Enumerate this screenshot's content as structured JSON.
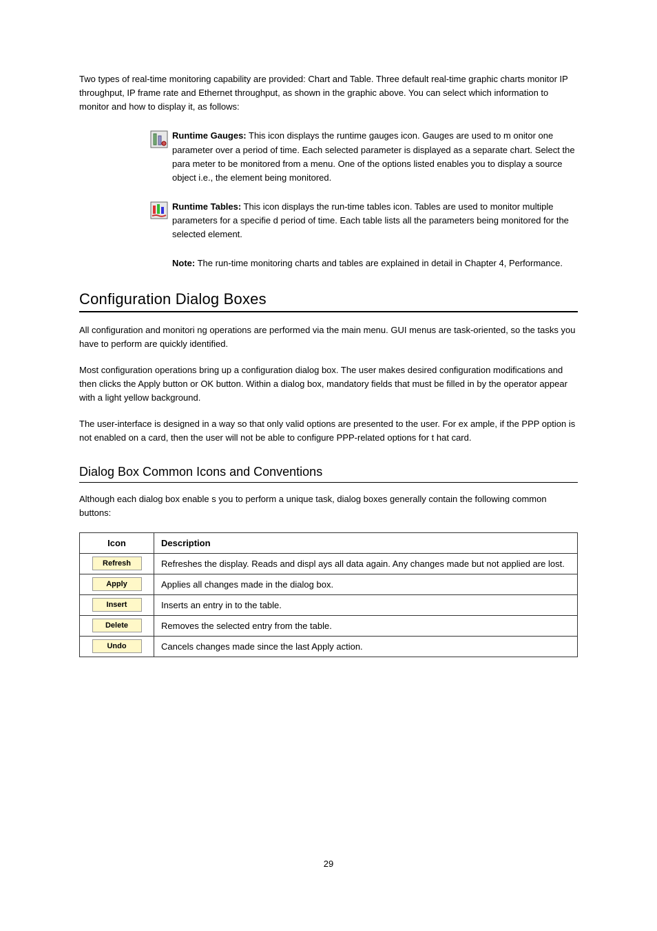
{
  "intro": "Two types of real-time monitoring capability are provided: Chart and Table. Three default real-time graphic charts monitor IP throughput, IP frame rate and Ethernet throughput, as shown in the graphic above. You can select which information to monitor and how to display it, as follows:",
  "items": [
    {
      "icon": "runtime-gauges",
      "lead": "Runtime Gauges:",
      "text": " This icon displays the runtime gauges icon. Gauges are used to m onitor one parameter over a period of time. Each selected parameter is displayed as a separate chart. Select the para meter to be monitored from a menu. One of the options listed enables you to display a source object i.e., the element being monitored."
    },
    {
      "icon": "runtime-tables",
      "lead": "Runtime Tables:",
      "text": " This icon displays the run-time tables icon. Tables are used to monitor multiple parameters for a specifie d period of time. Each table lists all the parameters being monitored for the selected element."
    }
  ],
  "noteLead": "Note:",
  "noteText": " The run-time monitoring charts and tables are explained in detail in Chapter 4, Performance.",
  "h1": "Configuration Dialog Boxes",
  "config1": "All configuration and monitori ng operations are performed via the main menu. GUI menus are task-oriented, so the tasks you have to perform are  quickly identified.",
  "config2": "Most configuration operations bring up a configuration dialog box. The user makes desired configuration modifications and then clicks the Apply button or OK button. Within a dialog box, mandatory fields that must be filled in by the operator appear with a light yellow background.",
  "config3": "The user-interface is designed in a way so that only valid options are presented to the user. For ex ample, if the PPP option is not enabled on a card, then the user will not be able to configure PPP-related options for t hat card.",
  "h2": "Dialog Box Common Icons and Conventions",
  "dlgIntro": "Although each dialog box enable s you to perform a unique task, dialog boxes generally contain the following common buttons:",
  "tableHeaders": {
    "icon": "Icon",
    "desc": "Description"
  },
  "rows": [
    {
      "btn": "Refresh",
      "desc": "Refreshes the display. Reads and displ ays all data again. Any changes made but not applied are lost."
    },
    {
      "btn": "Apply",
      "desc": "Applies all changes made in the dialog box."
    },
    {
      "btn": "Insert",
      "desc": "Inserts an entry in to the table."
    },
    {
      "btn": "Delete",
      "desc": "Removes the selected entry from the table."
    },
    {
      "btn": "Undo",
      "desc": "Cancels changes made since the last Apply action."
    }
  ],
  "pageNum": "29"
}
